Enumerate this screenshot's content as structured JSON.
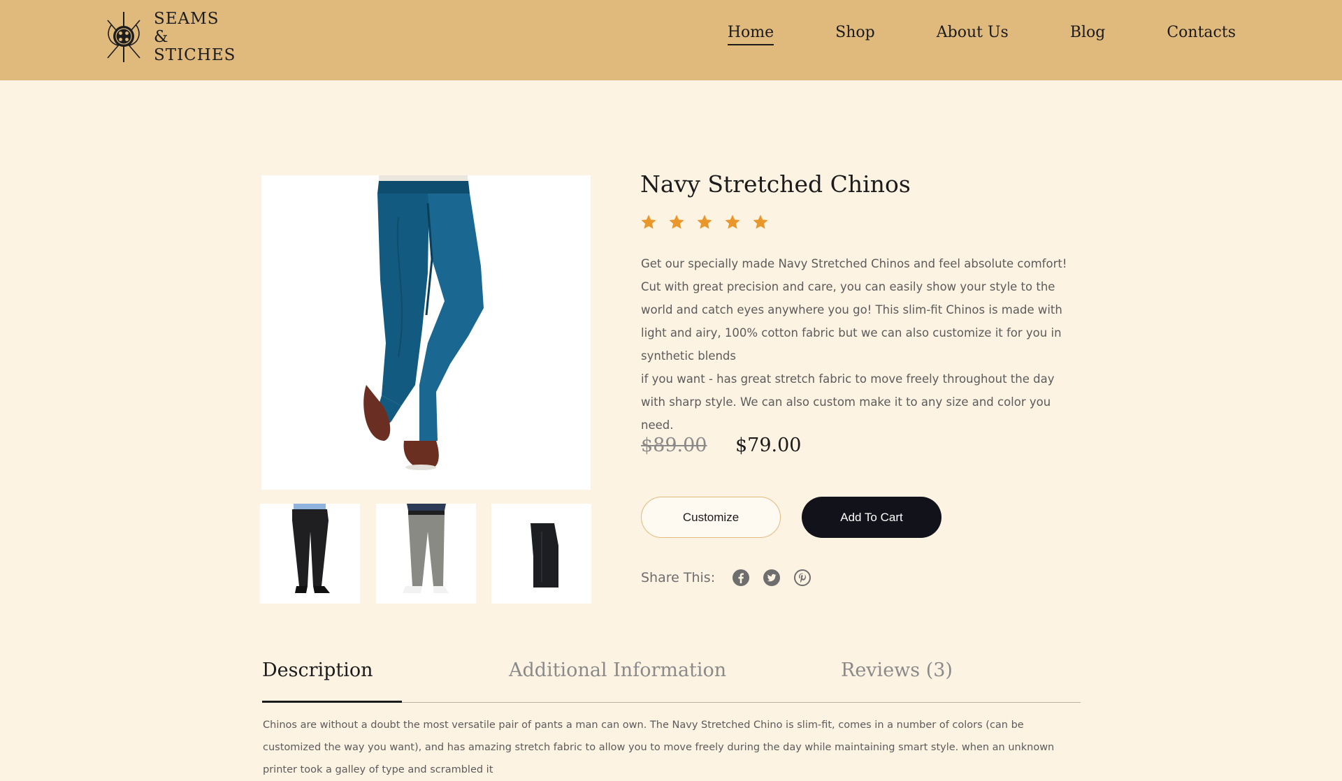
{
  "brand": {
    "name": "SEAMS &\nSTICHES",
    "logo_icon": "needle-button-logo-icon"
  },
  "nav": {
    "items": [
      {
        "label": "Home",
        "active": true
      },
      {
        "label": "Shop",
        "active": false
      },
      {
        "label": "About Us",
        "active": false
      },
      {
        "label": "Blog",
        "active": false
      },
      {
        "label": "Contacts",
        "active": false
      }
    ]
  },
  "gallery": {
    "main_image": "navy-chinos-photo",
    "thumbnails": [
      "black-chinos-photo",
      "grey-chinos-photo",
      "folded-black-chinos-photo"
    ]
  },
  "product": {
    "title": "Navy Stretched Chinos",
    "rating": 5,
    "rating_max": 5,
    "description_1": "Get our specially made Navy Stretched Chinos and feel absolute comfort! Cut with great precision and care, you can easily show your style to the world and catch eyes anywhere you go! This slim-fit Chinos is made with light and airy, 100% cotton fabric but we can also customize it for you in synthetic blends",
    "description_2": "if you want - has great stretch fabric to move freely throughout the day with sharp style. We can also custom make it to any size and color you need.",
    "price_old": "$89.00",
    "price_new": "$79.00",
    "customize_label": "Customize",
    "cart_label": "Add To Cart"
  },
  "share": {
    "label": "Share This:",
    "icons": [
      "facebook-icon",
      "twitter-icon",
      "pinterest-icon"
    ]
  },
  "tabs": {
    "items": [
      {
        "label": "Description",
        "active": true
      },
      {
        "label": "Additional Information",
        "active": false
      },
      {
        "label": "Reviews (3)",
        "active": false
      }
    ],
    "content": "Chinos are without a doubt the most versatile pair of pants a man can own. The Navy Stretched Chino is slim-fit, comes in a number of colors (can be customized the way you want), and has amazing stretch fabric to allow you to move freely during the day while maintaining smart style. when an unknown printer took a galley of type and scrambled it"
  },
  "colors": {
    "header_bg": "#e0b97d",
    "page_bg": "#fdf3e3",
    "star": "#e9962b",
    "button_dark": "#12121a"
  }
}
